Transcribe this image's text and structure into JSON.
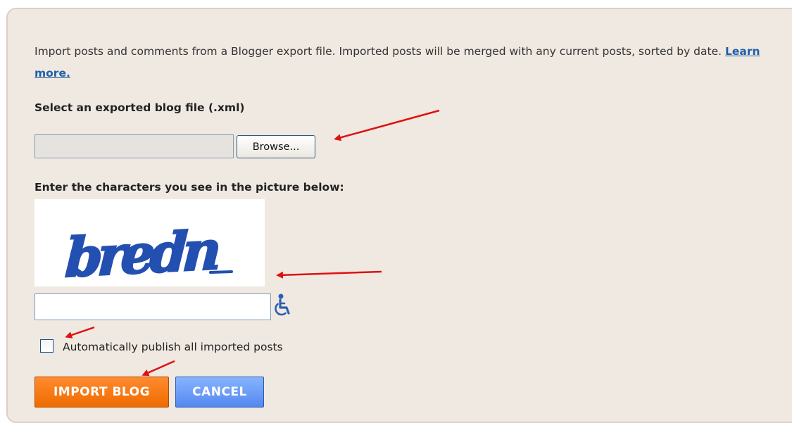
{
  "intro": {
    "text": "Import posts and comments from a Blogger export file. Imported posts will be merged with any current posts, sorted by date.",
    "learn_more": "Learn more."
  },
  "file_section": {
    "label": "Select an exported blog file (.xml)",
    "browse_label": "Browse..."
  },
  "captcha_section": {
    "label": "Enter the characters you see in the picture below:",
    "captcha_text": "bredn",
    "input_value": "",
    "accessibility_icon": "wheelchair-icon"
  },
  "publish_checkbox": {
    "label": "Automatically publish all imported posts",
    "checked": false
  },
  "buttons": {
    "import_label": "IMPORT BLOG",
    "cancel_label": "CANCEL"
  },
  "colors": {
    "panel_bg": "#f0e9e1",
    "link": "#1f5fa8",
    "import_button": "#f07800",
    "cancel_button": "#6699ff",
    "annotation_arrow": "#e01010",
    "captcha_ink": "#2350b0"
  }
}
